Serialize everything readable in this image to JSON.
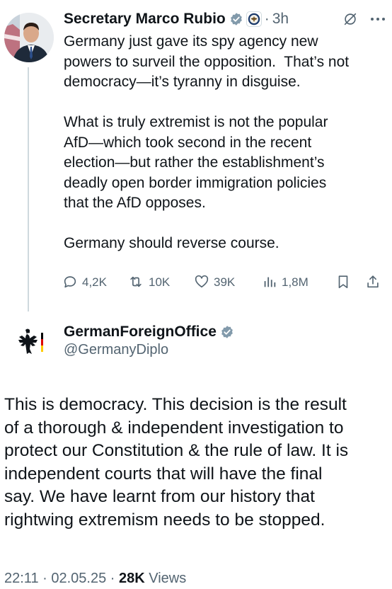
{
  "top_tweet": {
    "author_name": "Secretary Marco Rubio",
    "separator": "·",
    "time": "3h",
    "text": "Germany just gave its spy agency new\npowers to surveil the opposition.  That’s not\ndemocracy—it’s tyranny in disguise.\n\nWhat is truly extremist is not the popular\nAfD—which took second in the recent\nelection—but rather the establishment’s\ndeadly open border immigration policies\nthat the AfD opposes.\n\nGermany should reverse course.",
    "actions": {
      "replies": "4,2K",
      "reposts": "10K",
      "likes": "39K",
      "views": "1,8M"
    },
    "icons": [
      "verified-badge-icon",
      "state-department-seal-icon",
      "grok-icon",
      "more-icon",
      "reply-icon",
      "repost-icon",
      "like-icon",
      "views-icon",
      "bookmark-icon",
      "share-icon"
    ]
  },
  "reply_tweet": {
    "author_name": "GermanForeignOffice",
    "handle": "@GermanyDiplo",
    "text": "This is democracy. This decision is the result\nof a thorough & independent investigation to\nprotect our Constitution & the rule of law. It is\nindependent courts that will have the final\nsay. We have learnt from our history that\nrightwing extremism needs to be stopped.",
    "timestamp": "22:11 · 02.05.25 · ",
    "view_count": "28K",
    "views_label": " Views"
  },
  "colors": {
    "text": "#0f1419",
    "secondary": "#536471",
    "verified": "#829aab",
    "thread_line": "#cfd9de"
  }
}
